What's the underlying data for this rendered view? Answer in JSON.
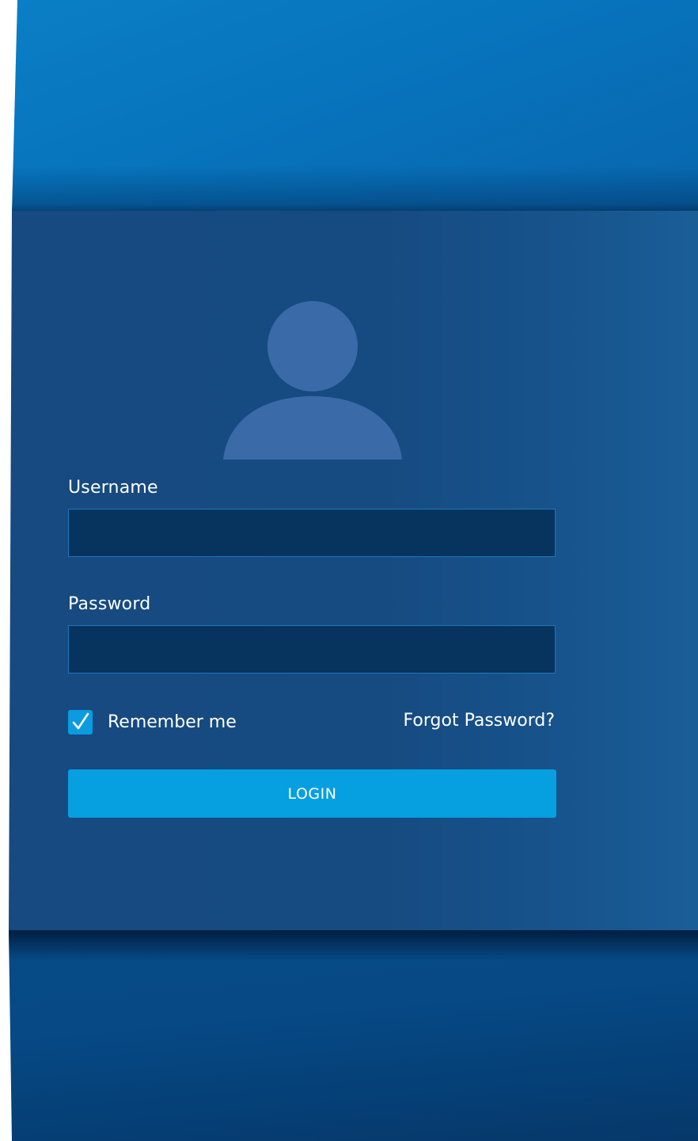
{
  "login_form": {
    "username_label": "Username",
    "username_value": "",
    "password_label": "Password",
    "password_value": "",
    "remember_me_label": "Remember me",
    "remember_me_checked": true,
    "forgot_password_label": "Forgot Password?",
    "login_button_label": "LOGIN"
  },
  "icons": {
    "avatar": "user-avatar-icon",
    "checkbox_mark": "checkmark-icon"
  },
  "colors": {
    "top_band": "#0774bd",
    "panel": "#164b81",
    "bottom_band": "#064985",
    "input_fill": "#06345f",
    "input_border": "#1f77bd",
    "accent": "#069fe0",
    "avatar": "#3a6aa8",
    "text": "#ffffff"
  }
}
